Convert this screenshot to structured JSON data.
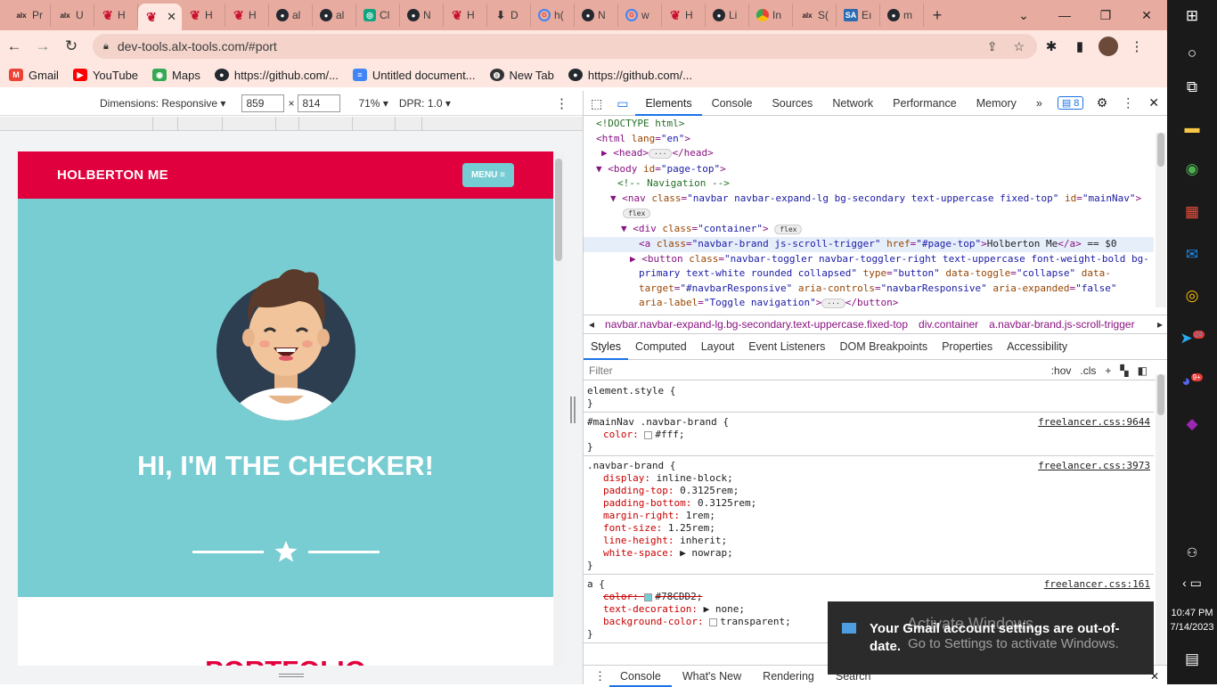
{
  "browser": {
    "tabs": [
      {
        "icon": "alx",
        "label": "Pr"
      },
      {
        "icon": "alx",
        "label": "U"
      },
      {
        "icon": "hb",
        "label": "H"
      },
      {
        "icon": "hb",
        "label": "",
        "active": true
      },
      {
        "icon": "hb",
        "label": "H"
      },
      {
        "icon": "hb",
        "label": "H"
      },
      {
        "icon": "gh",
        "label": "al"
      },
      {
        "icon": "gh",
        "label": "al"
      },
      {
        "icon": "cg",
        "label": "Cl"
      },
      {
        "icon": "gh",
        "label": "N"
      },
      {
        "icon": "hb",
        "label": "H"
      },
      {
        "icon": "dl",
        "label": "D"
      },
      {
        "icon": "g",
        "label": "h("
      },
      {
        "icon": "gh",
        "label": "N"
      },
      {
        "icon": "g",
        "label": "w"
      },
      {
        "icon": "hb",
        "label": "H"
      },
      {
        "icon": "gh",
        "label": "Li"
      },
      {
        "icon": "chr",
        "label": "In"
      },
      {
        "icon": "alx",
        "label": "S("
      },
      {
        "icon": "sa",
        "label": "Eı"
      },
      {
        "icon": "gh",
        "label": "m"
      }
    ],
    "new_tab": "+",
    "url": "dev-tools.alx-tools.com/#port",
    "bookmarks": [
      {
        "label": "Gmail",
        "icon": "gmail",
        "color": "#ea4335"
      },
      {
        "label": "YouTube",
        "icon": "youtube",
        "color": "#ff0000"
      },
      {
        "label": "Maps",
        "icon": "maps",
        "color": "#34a853"
      },
      {
        "label": "https://github.com/...",
        "icon": "github",
        "color": "#24292f"
      },
      {
        "label": "Untitled document...",
        "icon": "docs",
        "color": "#4285f4"
      },
      {
        "label": "New Tab",
        "icon": "globe",
        "color": "#333333"
      },
      {
        "label": "https://github.com/...",
        "icon": "github",
        "color": "#24292f"
      }
    ]
  },
  "device_toolbar": {
    "dimensions_label": "Dimensions: Responsive",
    "width": "859",
    "times": "×",
    "height": "814",
    "zoom": "71%",
    "dpr": "DPR: 1.0"
  },
  "site": {
    "brand": "HOLBERTON ME",
    "menu": "MENU ≡",
    "hero_title": "HI, I'M THE CHECKER!",
    "portfolio": "PORTFOLIO",
    "nav_color": "#e0003d",
    "hero_color": "#78cdd3"
  },
  "devtools": {
    "tabs": [
      "Elements",
      "Console",
      "Sources",
      "Network",
      "Performance",
      "Memory"
    ],
    "more": "»",
    "issues_count": "8",
    "dom_lines": [
      {
        "indent": 14,
        "html": "<span class='cm'>&lt;!DOCTYPE html&gt;</span>"
      },
      {
        "indent": 14,
        "html": "&lt;html <span class='att'>lang</span>=<span class='av'>\"en\"</span>&gt;"
      },
      {
        "indent": 20,
        "html": "▶ &lt;head&gt;<span class='pill'>···</span>&lt;/head&gt;"
      },
      {
        "indent": 14,
        "html": "▼ &lt;body <span class='att'>id</span>=<span class='av'>\"page-top\"</span>&gt;"
      },
      {
        "indent": 38,
        "html": "<span class='cm'>&lt;!-- Navigation --&gt;</span>"
      },
      {
        "indent": 30,
        "html": "▼ &lt;nav <span class='att'>class</span>=<span class='av'>\"navbar navbar-expand-lg bg-secondary text-uppercase fixed-top\"</span> <span class='att'>id</span>=<span class='av'>\"mainNav\"</span>&gt;"
      },
      {
        "indent": 44,
        "html": "<span class='pill'>flex</span>"
      },
      {
        "indent": 42,
        "html": "▼ &lt;div <span class='att'>class</span>=<span class='av'>\"container\"</span>&gt; <span class='pill'>flex</span>"
      },
      {
        "indent": 62,
        "html": "&lt;a <span class='att'>class</span>=<span class='av'>\"navbar-brand js-scroll-trigger\"</span> <span class='att'>href</span>=<span class='av'>\"#page-top\"</span>&gt;<span class='tx'>Holberton Me</span>&lt;/a&gt; <span class='tx'>== $0</span>",
        "selected": true
      },
      {
        "indent": 52,
        "html": "▶ &lt;button <span class='att'>class</span>=<span class='av'>\"navbar-toggler navbar-toggler-right text-uppercase font-weight-bold bg-</span>"
      },
      {
        "indent": 62,
        "html": "<span class='av'>primary text-white rounded collapsed\"</span> <span class='att'>type</span>=<span class='av'>\"button\"</span> <span class='att'>data-toggle</span>=<span class='av'>\"collapse\"</span> <span class='att'>data-</span>"
      },
      {
        "indent": 62,
        "html": "<span class='att'>target</span>=<span class='av'>\"#navbarResponsive\"</span> <span class='att'>aria-controls</span>=<span class='av'>\"navbarResponsive\"</span> <span class='att'>aria-expanded</span>=<span class='av'>\"false\"</span>"
      },
      {
        "indent": 62,
        "html": "<span class='att'>aria-label</span>=<span class='av'>\"Toggle navigation\"</span>&gt;<span class='pill'>···</span>&lt;/button&gt;"
      }
    ],
    "breadcrumbs": [
      "navbar.navbar-expand-lg.bg-secondary.text-uppercase.fixed-top",
      "div.container",
      "a.navbar-brand.js-scroll-trigger"
    ],
    "subtabs": [
      "Styles",
      "Computed",
      "Layout",
      "Event Listeners",
      "DOM Breakpoints",
      "Properties",
      "Accessibility"
    ],
    "filter_placeholder": "Filter",
    "filter_tools": [
      ":hov",
      ".cls",
      "+"
    ],
    "rules": [
      {
        "selector": "element.style {",
        "source": "",
        "props": []
      },
      {
        "selector": "#mainNav .navbar-brand {",
        "source": "freelancer.css:9644",
        "props": [
          {
            "name": "color",
            "value": "#fff;",
            "swatch": "#ffffff"
          }
        ]
      },
      {
        "selector": ".navbar-brand {",
        "source": "freelancer.css:3973",
        "props": [
          {
            "name": "display",
            "value": "inline-block;"
          },
          {
            "name": "padding-top",
            "value": "0.3125rem;"
          },
          {
            "name": "padding-bottom",
            "value": "0.3125rem;"
          },
          {
            "name": "margin-right",
            "value": "1rem;"
          },
          {
            "name": "font-size",
            "value": "1.25rem;"
          },
          {
            "name": "line-height",
            "value": "inherit;"
          },
          {
            "name": "white-space",
            "value": "▶ nowrap;"
          }
        ]
      },
      {
        "selector": "a {",
        "source": "freelancer.css:161",
        "props": [
          {
            "name": "color",
            "value": "#78CDD2;",
            "swatch": "#78cdd2",
            "struck": true
          },
          {
            "name": "text-decoration",
            "value": "▶ none;"
          },
          {
            "name": "background-color",
            "value": "transparent;",
            "swatch": "#ffffff"
          }
        ]
      }
    ],
    "drawer_tabs": [
      "Console",
      "What's New",
      "Rendering",
      "Search"
    ]
  },
  "notification": {
    "message": "Your Gmail account settings are out-of-date.",
    "watermark_title": "Activate Windows",
    "watermark_sub": "Go to Settings to activate Windows."
  },
  "taskbar": {
    "time": "10:47 PM",
    "date": "7/14/2023",
    "telegram_badge": "24",
    "discord_badge": "9+"
  }
}
